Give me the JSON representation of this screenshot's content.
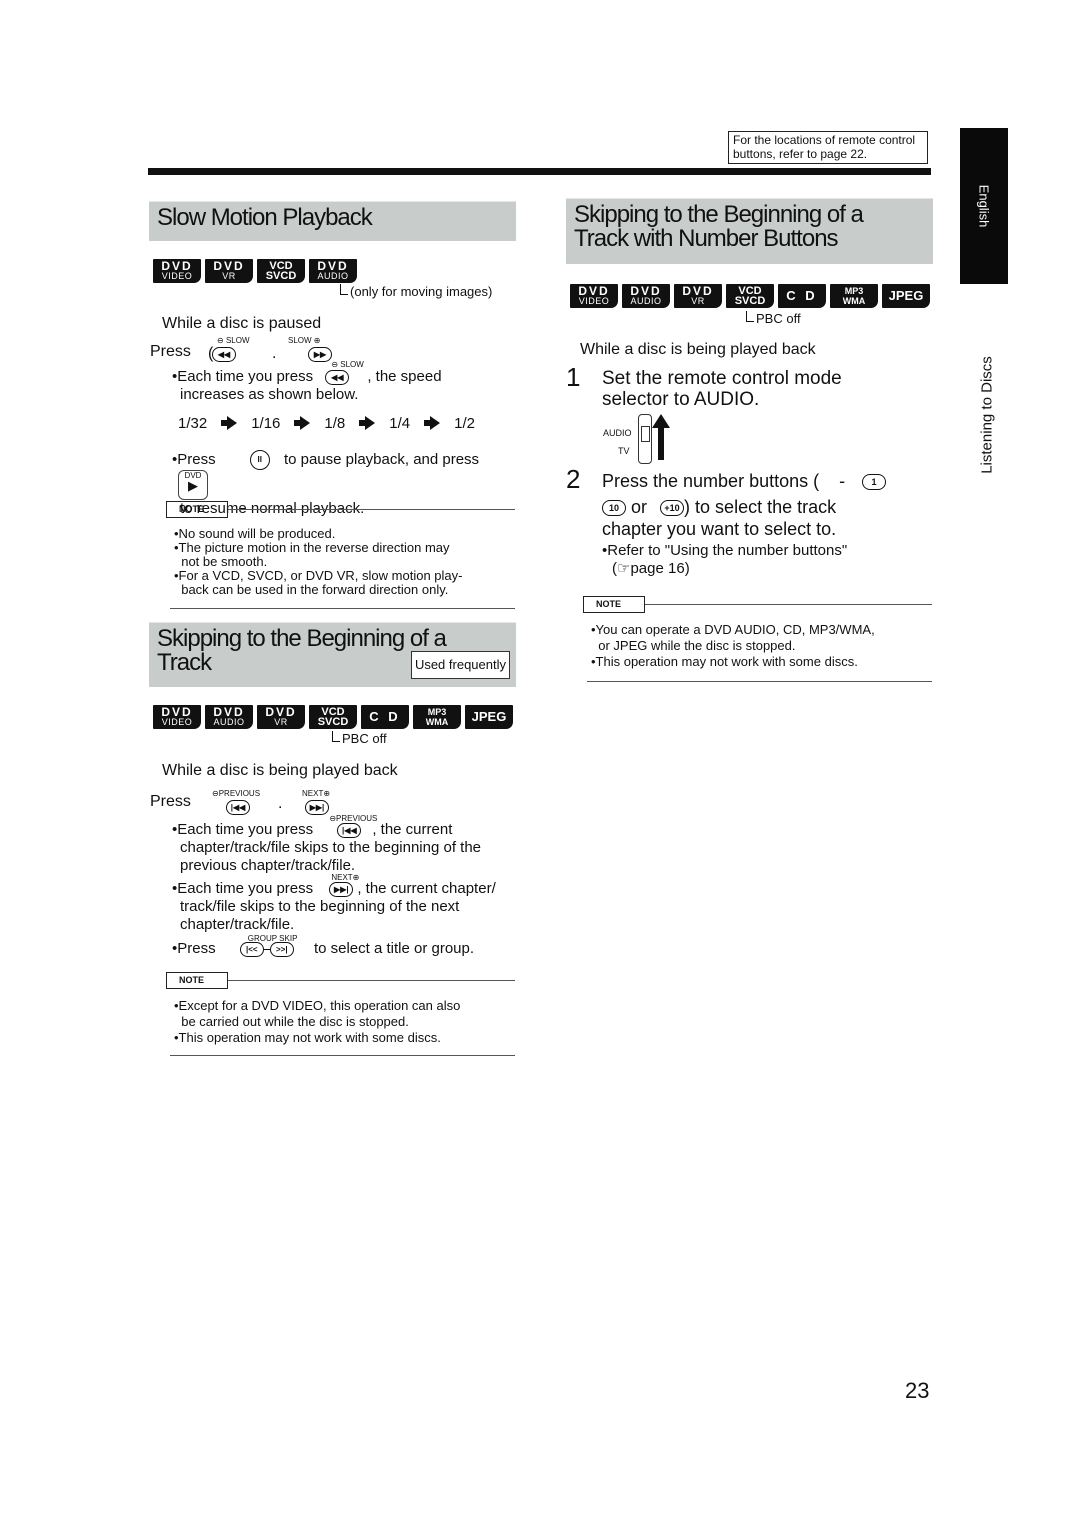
{
  "header": {
    "reference_note": "For the locations of remote control buttons, refer to page 22.",
    "language_tab": "English",
    "side_label": "Listening to Discs"
  },
  "slow_motion": {
    "title": "Slow Motion Playback",
    "badges": [
      {
        "top": "DVD",
        "bottom": "VIDEO"
      },
      {
        "top": "DVD",
        "bottom": "VR"
      },
      {
        "top": "VCD",
        "bottom": "SVCD"
      },
      {
        "top": "DVD",
        "bottom": "AUDIO"
      }
    ],
    "badge_note": "only for moving images",
    "condition": "While a disc is paused",
    "press_prefix": "Press",
    "press_sep": ".",
    "slow_minus_label": "SLOW",
    "slow_plus_label": "SLOW",
    "bullet1_a": "•Each time you press",
    "bullet1_b": ", the speed",
    "bullet1_c": "increases as shown below.",
    "speeds": [
      "1/32",
      "1/16",
      "1/8",
      "1/4",
      "1/2"
    ],
    "bullet2_a": "•Press",
    "bullet2_b": "to pause playback, and press",
    "bullet2_c": "to resume normal playback.",
    "dvd_label": "DVD",
    "note_label": "NOTE",
    "notes": [
      "•No sound will be produced.",
      "•The picture motion in the reverse direction may",
      "  not be smooth.",
      "•For a VCD, SVCD, or DVD VR, slow motion play-",
      "  back can be used in the forward direction only."
    ]
  },
  "skip_track": {
    "title_line1": "Skipping to the Beginning of a",
    "title_line2": "Track",
    "used_frequently": "Used frequently",
    "badges": [
      {
        "top": "DVD",
        "bottom": "VIDEO"
      },
      {
        "top": "DVD",
        "bottom": "AUDIO"
      },
      {
        "top": "DVD",
        "bottom": "VR"
      },
      {
        "top": "VCD",
        "bottom": "SVCD"
      },
      {
        "top": "C D",
        "bottom": ""
      },
      {
        "top": "MP3",
        "bottom": "WMA"
      },
      {
        "top": "JPEG",
        "bottom": ""
      }
    ],
    "badge_note": "PBC off",
    "condition": "While a disc is being played back",
    "press_prefix": "Press",
    "press_sep": ".",
    "previous_label": "PREVIOUS",
    "next_label": "NEXT",
    "bullet1_a": "•Each time you press",
    "bullet1_b": ", the current",
    "bullet1_c": "chapter/track/file skips to the beginning of the",
    "bullet1_d": "previous chapter/track/file.",
    "bullet2_a": "•Each time you press",
    "bullet2_b": ", the current chapter/",
    "bullet2_c": "track/file skips to the beginning of the next",
    "bullet2_d": "chapter/track/file.",
    "bullet3_a": "•Press",
    "bullet3_b": "to select a title or group.",
    "group_skip_label": "GROUP SKIP",
    "note_label": "NOTE",
    "notes": [
      "•Except for a DVD VIDEO, this operation can also",
      "  be carried out while the disc is stopped.",
      "•This operation may not work with some discs."
    ]
  },
  "skip_number": {
    "title_line1": "Skipping to the Beginning of a",
    "title_line2": "Track with Number Buttons",
    "badges": [
      {
        "top": "DVD",
        "bottom": "VIDEO"
      },
      {
        "top": "DVD",
        "bottom": "AUDIO"
      },
      {
        "top": "DVD",
        "bottom": "VR"
      },
      {
        "top": "VCD",
        "bottom": "SVCD"
      },
      {
        "top": "C D",
        "bottom": ""
      },
      {
        "top": "MP3",
        "bottom": "WMA"
      },
      {
        "top": "JPEG",
        "bottom": ""
      }
    ],
    "badge_note": "PBC off",
    "condition": "While a disc is being played back",
    "step1_num": "1",
    "step1_line1": "Set the remote control mode",
    "step1_line2": "selector to AUDIO.",
    "switch_audio": "AUDIO",
    "switch_tv": "TV",
    "step2_num": "2",
    "step2_line1": "Press the number buttons (",
    "step2_dash": "-",
    "btn_1": "1",
    "btn_10": "10",
    "btn_plus10": "+10",
    "step2_or": "or",
    "step2_line2": ") to select the track",
    "step2_line3": "chapter you want to select to.",
    "bullet_a": "•Refer to \"Using the number buttons\"",
    "bullet_b": "page 16",
    "note_label": "NOTE",
    "notes": [
      "•You can operate a DVD AUDIO, CD, MP3/WMA,",
      "  or JPEG while the disc is stopped.",
      "•This operation may not work with some discs."
    ]
  },
  "footer": {
    "page_number": "23"
  }
}
